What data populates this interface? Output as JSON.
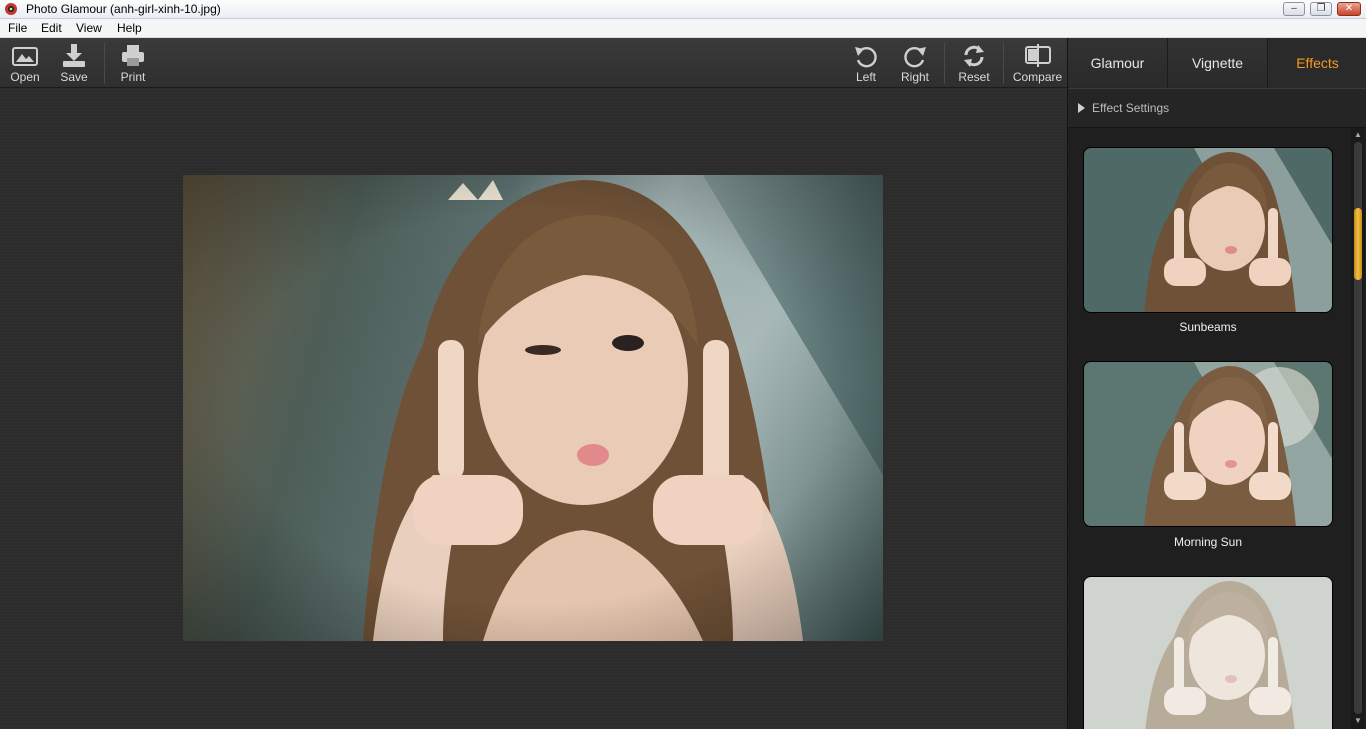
{
  "window": {
    "title": "Photo Glamour (anh-girl-xinh-10.jpg)",
    "controls": {
      "minimize": "–",
      "maximize": "❐",
      "close": "✕"
    }
  },
  "menu": {
    "file": "File",
    "edit": "Edit",
    "view": "View",
    "help": "Help"
  },
  "toolbar": {
    "open": "Open",
    "save": "Save",
    "print": "Print",
    "left": "Left",
    "right": "Right",
    "reset": "Reset",
    "compare": "Compare"
  },
  "panel": {
    "tabs": {
      "glamour": "Glamour",
      "vignette": "Vignette",
      "effects": "Effects"
    },
    "active_tab": "Effects",
    "effect_settings": "Effect Settings",
    "effects": [
      {
        "label": "Sunbeams"
      },
      {
        "label": "Morning Sun"
      },
      {
        "label": ""
      }
    ]
  },
  "colors": {
    "accent": "#f39a1f",
    "scroll": "#f2c047"
  },
  "icons": [
    "open-icon",
    "save-icon",
    "print-icon",
    "rotate-left-icon",
    "rotate-right-icon",
    "reset-icon",
    "compare-icon"
  ]
}
